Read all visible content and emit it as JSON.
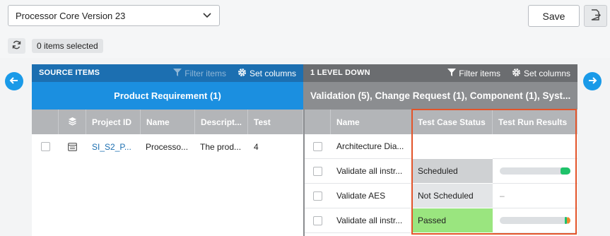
{
  "toolbar": {
    "project_select": "Processor Core Version 23",
    "save_label": "Save",
    "selection_badge": "0 items selected"
  },
  "source": {
    "header_title": "SOURCE ITEMS",
    "filter_label": "Filter items",
    "set_columns_label": "Set columns",
    "type_title": "Product Requirement (1)",
    "columns": [
      "Project ID",
      "Name",
      "Descript...",
      "Test"
    ],
    "rows": [
      {
        "project_id": "SI_S2_P...",
        "name": "Processo...",
        "description": "The prod...",
        "test": "4"
      }
    ]
  },
  "target": {
    "header_title": "1 LEVEL DOWN",
    "filter_label": "Filter items",
    "set_columns_label": "Set columns",
    "type_title": "Validation (5), Change Request (1), Component (1), Syst...",
    "columns": [
      "Name",
      "Test Case Status",
      "Test Run Results"
    ],
    "rows": [
      {
        "name": "Architecture Dia...",
        "status": "",
        "status_color": "#ffffff",
        "result": null
      },
      {
        "name": "Validate all instr...",
        "status": "Scheduled",
        "status_color": "#cfd1d3",
        "result": {
          "type": "bar",
          "segments": [
            {
              "color": "#1fc26a",
              "fraction": 0.14
            }
          ]
        }
      },
      {
        "name": "Validate AES",
        "status": "Not Scheduled",
        "status_color": "#e3e5e7",
        "result": {
          "type": "text",
          "text": "–"
        }
      },
      {
        "name": "Validate all instr...",
        "status": "Passed",
        "status_color": "#9ae57f",
        "result": {
          "type": "bar",
          "segments": [
            {
              "color": "#f08a2c",
              "fraction": 0.05
            },
            {
              "color": "#1fc26a",
              "fraction": 0.03
            }
          ]
        }
      }
    ]
  },
  "colors": {
    "source_header": "#1c6fb1",
    "source_subheader": "#1b8fe0",
    "target_header": "#6b6d70",
    "highlight": "#e3542a"
  },
  "icons": [
    "chevron-down-icon",
    "export-icon",
    "refresh-icon",
    "arrow-left-icon",
    "arrow-right-icon",
    "filter-icon",
    "gear-icon",
    "stack-icon",
    "document-icon"
  ]
}
